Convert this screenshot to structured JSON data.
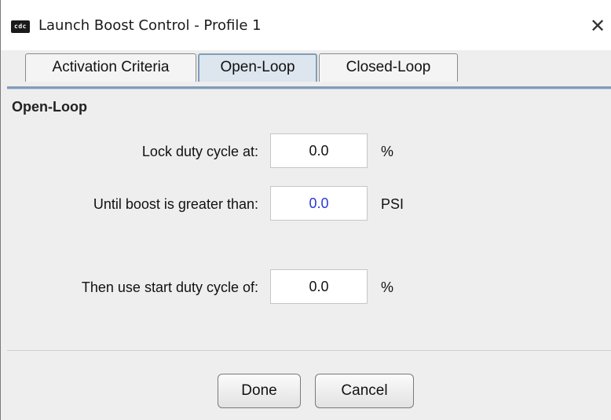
{
  "window": {
    "app_icon_text": "cdc",
    "title": "Launch Boost Control - Profile 1",
    "close_glyph": "✕"
  },
  "tabs": [
    {
      "label": "Activation Criteria",
      "active": false
    },
    {
      "label": "Open-Loop",
      "active": true
    },
    {
      "label": "Closed-Loop",
      "active": false
    }
  ],
  "panel": {
    "section_title": "Open-Loop",
    "rows": [
      {
        "label": "Lock duty cycle at:",
        "value": "0.0",
        "unit": "%"
      },
      {
        "label": "Until boost is greater than:",
        "value": "0.0",
        "unit": "PSI"
      },
      {
        "label": "Then use start duty cycle of:",
        "value": "0.0",
        "unit": "%"
      }
    ]
  },
  "buttons": {
    "done": "Done",
    "cancel": "Cancel"
  },
  "colors": {
    "active_tab_border": "#7f9db9",
    "highlight_value": "#2b39d6"
  }
}
